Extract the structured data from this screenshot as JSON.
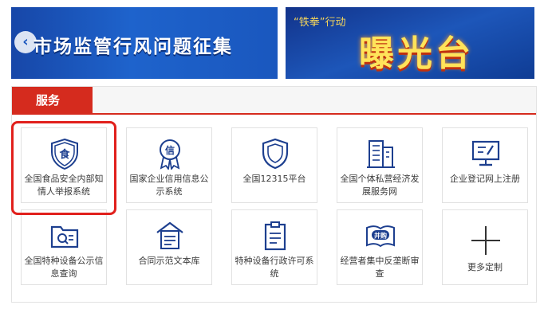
{
  "banners": {
    "left": {
      "title": "市场监管行风问题征集",
      "arrow_icon": "chevron-left-icon"
    },
    "right": {
      "subtitle": "“铁拳”行动",
      "title": "曝光台"
    }
  },
  "services": {
    "tab_label": "服务",
    "accent_color": "#d52b1e",
    "icon_color": "#1d3f8f",
    "highlight_color": "#e1201c",
    "items": [
      {
        "label": "全国食品安全内部知情人举报系统",
        "icon": "food-shield-icon",
        "icon_text": "食"
      },
      {
        "label": "国家企业信用信息公示系统",
        "icon": "credit-medal-icon",
        "icon_text": "信"
      },
      {
        "label": "全国12315平台",
        "icon": "shield-icon"
      },
      {
        "label": "全国个体私营经济发展服务网",
        "icon": "buildings-icon"
      },
      {
        "label": "企业登记网上注册",
        "icon": "monitor-edit-icon"
      },
      {
        "label": "全国特种设备公示信息查询",
        "icon": "folder-search-icon"
      },
      {
        "label": "合同示范文本库",
        "icon": "document-home-icon"
      },
      {
        "label": "特种设备行政许可系统",
        "icon": "clipboard-icon"
      },
      {
        "label": "经营者集中反垄断审查",
        "icon": "merger-book-icon",
        "icon_text": "并购"
      },
      {
        "label": "更多定制",
        "icon": "plus-icon"
      }
    ]
  }
}
